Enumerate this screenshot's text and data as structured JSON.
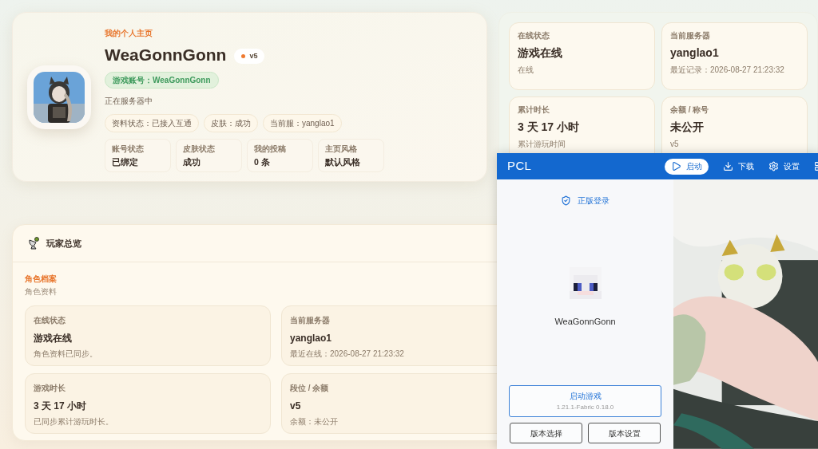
{
  "profile": {
    "kicker": "我的个人主页",
    "name": "WeaGonnGonn",
    "level_badge": "v5",
    "account": "游戏账号：WeaGonnGonn",
    "status_text": "正在服务器中",
    "chips": [
      "资料状态：已接入互通",
      "皮肤：成功",
      "当前服：yanglao1"
    ],
    "stats": [
      {
        "label": "账号状态",
        "value": "已绑定"
      },
      {
        "label": "皮肤状态",
        "value": "成功"
      },
      {
        "label": "我的投稿",
        "value": "0 条"
      },
      {
        "label": "主页风格",
        "value": "默认风格"
      }
    ]
  },
  "summary_cards": [
    {
      "label": "在线状态",
      "value": "游戏在线",
      "note": "在线"
    },
    {
      "label": "当前服务器",
      "value": "yanglao1",
      "note": "最近记录：2026-08-27 21:23:32"
    },
    {
      "label": "累计时长",
      "value": "3 天 17 小时",
      "note": "累计游玩时间"
    },
    {
      "label": "余额 / 称号",
      "value": "未公开",
      "note": "v5"
    }
  ],
  "overview": {
    "title": "玩家总览",
    "section_title": "角色档案",
    "section_subtitle": "角色资料",
    "cards": [
      {
        "label": "在线状态",
        "value": "游戏在线",
        "note": "角色资料已同步。"
      },
      {
        "label": "当前服务器",
        "value": "yanglao1",
        "note": "最近在线：2026-08-27 21:23:32"
      },
      {
        "label": "游戏时长",
        "value": "3 天 17 小时",
        "note": "已同步累计游玩时长。"
      },
      {
        "label": "段位 / 余额",
        "value": "v5",
        "note": "余额：未公开"
      }
    ]
  },
  "launcher": {
    "title": "PCL",
    "tabs": [
      {
        "kind": "play",
        "label": "启动",
        "selected": true
      },
      {
        "kind": "download",
        "label": "下载",
        "selected": false
      },
      {
        "kind": "settings",
        "label": "设置",
        "selected": false
      },
      {
        "kind": "more",
        "selected": false
      }
    ],
    "login_link": "正版登录",
    "player_name": "WeaGonnGonn",
    "launch_button": "启动游戏",
    "version": "1.21.1-Fabric 0.18.0",
    "buttons": [
      "版本选择",
      "版本设置"
    ]
  }
}
